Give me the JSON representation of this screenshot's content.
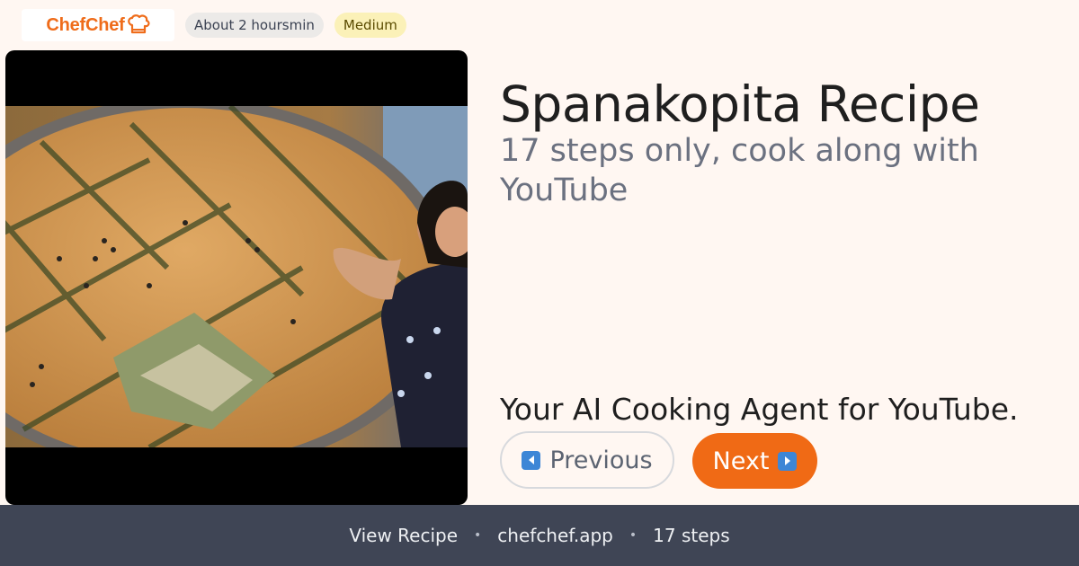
{
  "brand": {
    "name": "ChefChef",
    "accent": "#ef6c1a"
  },
  "meta": {
    "time": "About 2 hoursmin",
    "difficulty": "Medium"
  },
  "recipe": {
    "title": "Spanakopita Recipe",
    "subtitle": "17 steps only, cook along with YouTube"
  },
  "tagline": "Your AI Cooking Agent for YouTube.",
  "nav": {
    "previous_label": "Previous",
    "previous_icon": "left-arrow-icon",
    "next_label": "Next",
    "next_icon": "right-arrow-icon"
  },
  "footer": {
    "items": [
      "View Recipe",
      "chefchef.app",
      "17 steps"
    ],
    "separator": "•"
  },
  "colors": {
    "background": "#fff7f2",
    "primary_button": "#f06a15",
    "footer_bg": "#3f4555",
    "difficulty_badge": "#fbf1b8"
  }
}
